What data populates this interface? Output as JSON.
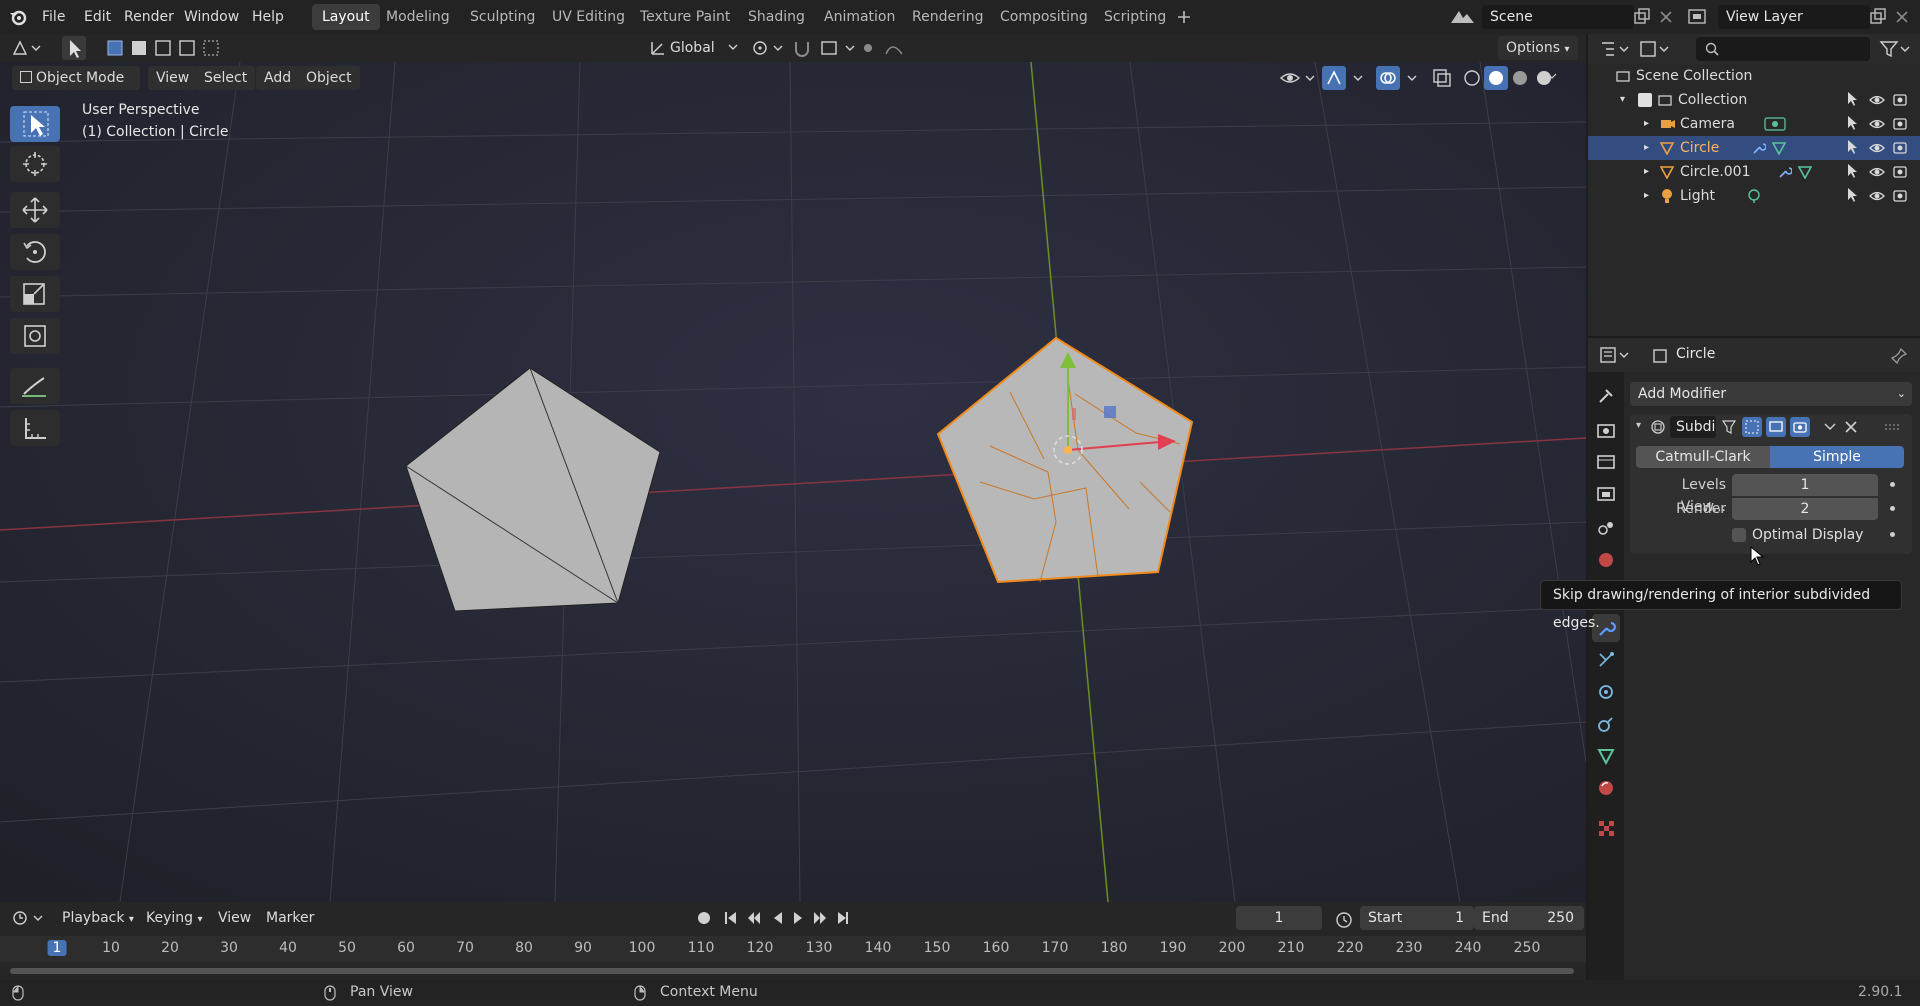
{
  "menu": {
    "file": "File",
    "edit": "Edit",
    "render": "Render",
    "window": "Window",
    "help": "Help"
  },
  "workspaces": [
    "Layout",
    "Modeling",
    "Sculpting",
    "UV Editing",
    "Texture Paint",
    "Shading",
    "Animation",
    "Rendering",
    "Compositing",
    "Scripting"
  ],
  "active_workspace": "Layout",
  "scene_field": "Scene",
  "view_layer_field": "View Layer",
  "viewport_header": {
    "mode": "Object Mode",
    "view": "View",
    "select": "Select",
    "add": "Add",
    "object": "Object",
    "transform": "Global",
    "options": "Options"
  },
  "viewport_overlay": {
    "line1": "User Perspective",
    "line2": "(1) Collection | Circle"
  },
  "outliner": {
    "root": "Scene Collection",
    "collection": "Collection",
    "items": [
      "Camera",
      "Circle",
      "Circle.001",
      "Light"
    ],
    "selected": "Circle"
  },
  "properties": {
    "object_name": "Circle",
    "add_modifier": "Add Modifier",
    "modifier_name": "Subdi",
    "type_a": "Catmull-Clark",
    "type_b": "Simple",
    "levels_label": "Levels View...",
    "levels_value": "1",
    "render_label": "Render",
    "render_value": "2",
    "optimal_label": "Optimal Display"
  },
  "tooltip": "Skip drawing/rendering of interior subdivided edges.",
  "timeline": {
    "playback": "Playback",
    "keying": "Keying",
    "view": "View",
    "marker": "Marker",
    "current_frame": "1",
    "start_label": "Start",
    "start_value": "1",
    "end_label": "End",
    "end_value": "250",
    "ruler": [
      "1",
      "10",
      "20",
      "30",
      "40",
      "50",
      "60",
      "70",
      "80",
      "90",
      "100",
      "110",
      "120",
      "130",
      "140",
      "150",
      "160",
      "170",
      "180",
      "190",
      "200",
      "210",
      "220",
      "230",
      "240",
      "250"
    ]
  },
  "status": {
    "pan_view": "Pan View",
    "context_menu": "Context Menu",
    "version": "2.90.1"
  },
  "colors": {
    "accent": "#4772b3",
    "selected_row": "#334d80",
    "selection_orange": "#f08a1a"
  }
}
